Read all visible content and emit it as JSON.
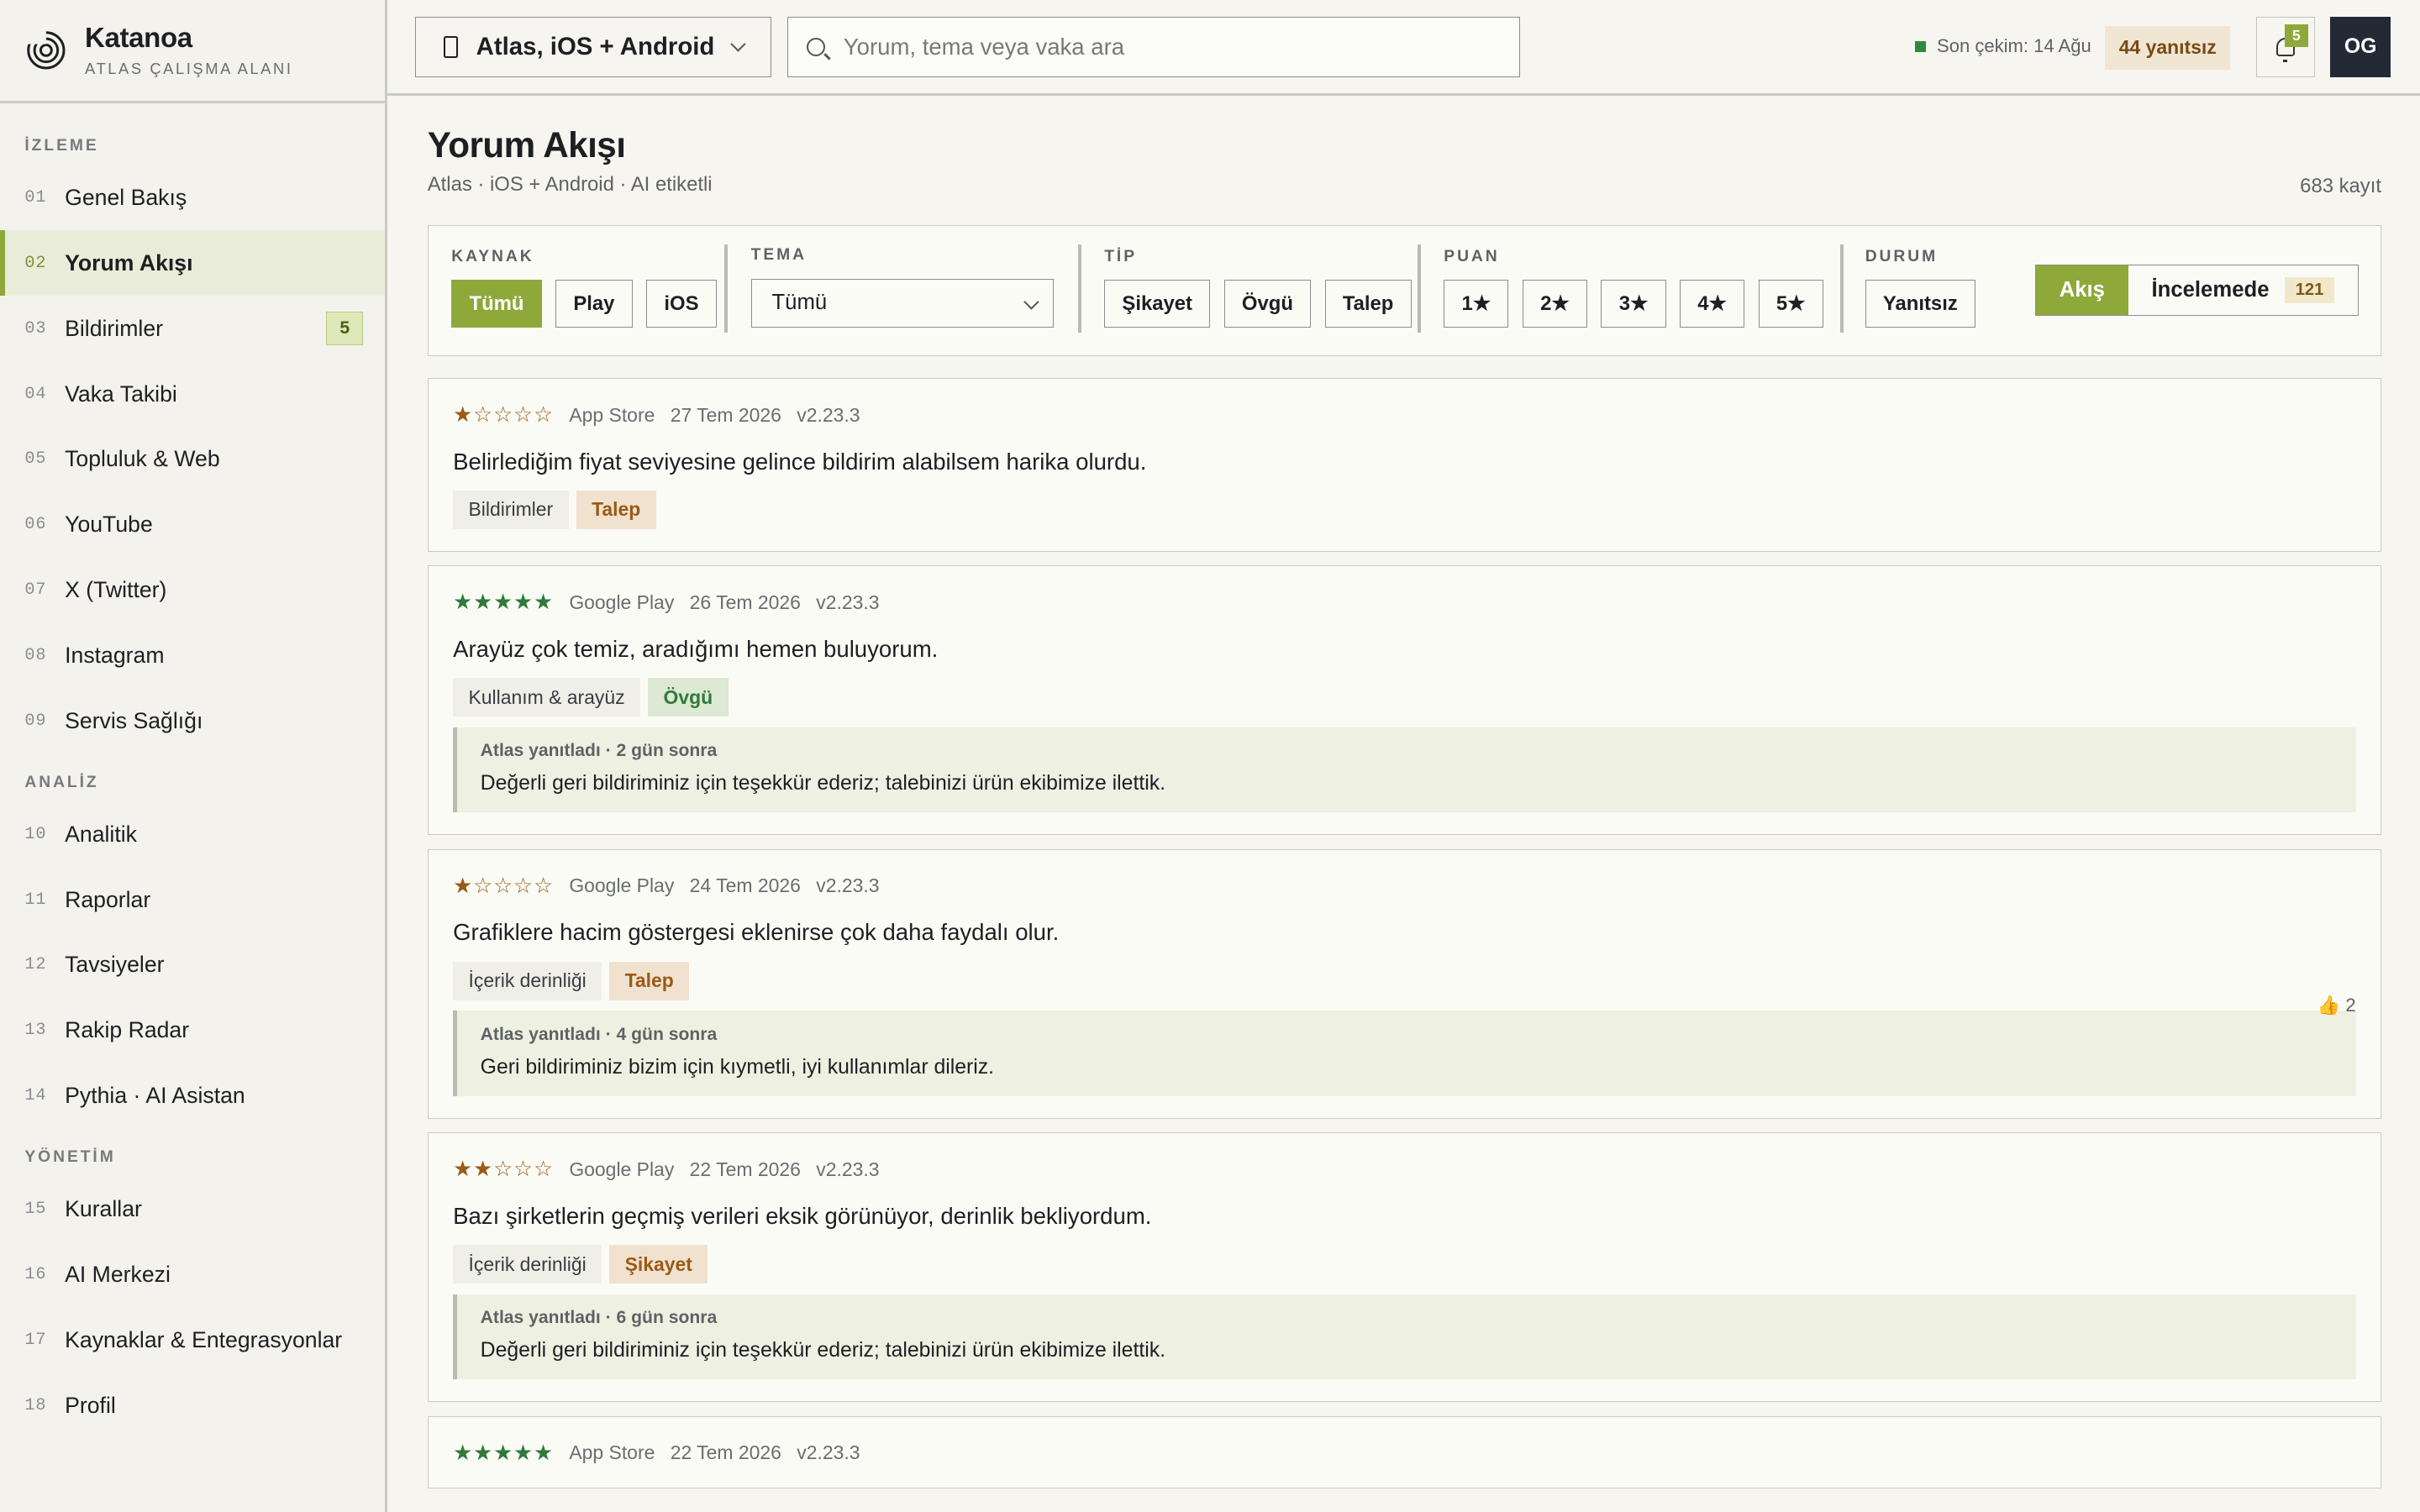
{
  "brand": {
    "name": "Katanoa",
    "subtitle": "ATLAS ÇALIŞMA ALANI"
  },
  "sidebar": {
    "sections": [
      {
        "title": "İZLEME",
        "items": [
          {
            "num": "01",
            "label": "Genel Bakış"
          },
          {
            "num": "02",
            "label": "Yorum Akışı",
            "active": true
          },
          {
            "num": "03",
            "label": "Bildirimler",
            "badge": "5"
          },
          {
            "num": "04",
            "label": "Vaka Takibi"
          },
          {
            "num": "05",
            "label": "Topluluk & Web"
          },
          {
            "num": "06",
            "label": "YouTube"
          },
          {
            "num": "07",
            "label": "X (Twitter)"
          },
          {
            "num": "08",
            "label": "Instagram"
          },
          {
            "num": "09",
            "label": "Servis Sağlığı"
          }
        ]
      },
      {
        "title": "ANALİZ",
        "items": [
          {
            "num": "10",
            "label": "Analitik"
          },
          {
            "num": "11",
            "label": "Raporlar"
          },
          {
            "num": "12",
            "label": "Tavsiyeler"
          },
          {
            "num": "13",
            "label": "Rakip Radar"
          },
          {
            "num": "14",
            "label": "Pythia · AI Asistan"
          }
        ]
      },
      {
        "title": "YÖNETİM",
        "items": [
          {
            "num": "15",
            "label": "Kurallar"
          },
          {
            "num": "16",
            "label": "AI Merkezi"
          },
          {
            "num": "17",
            "label": "Kaynaklar & Entegrasyonlar"
          },
          {
            "num": "18",
            "label": "Profil"
          }
        ]
      }
    ]
  },
  "topbar": {
    "workspace": "Atlas, iOS + Android",
    "search_placeholder": "Yorum, tema veya vaka ara",
    "last_sync": "Son çekim: 14 Ağu",
    "unanswered": "44 yanıtsız",
    "notifications": "5",
    "avatar": "OG"
  },
  "page": {
    "title": "Yorum Akışı",
    "subtitle": "Atlas · iOS + Android · AI etiketli",
    "count": "683 kayıt"
  },
  "filters": {
    "source": {
      "label": "KAYNAK",
      "options": [
        "Tümü",
        "Play",
        "iOS"
      ],
      "active": "Tümü"
    },
    "theme": {
      "label": "TEMA",
      "value": "Tümü"
    },
    "type": {
      "label": "TİP",
      "options": [
        "Şikayet",
        "Övgü",
        "Talep"
      ]
    },
    "rating": {
      "label": "PUAN",
      "options": [
        "1★",
        "2★",
        "3★",
        "4★",
        "5★"
      ]
    },
    "status": {
      "label": "DURUM",
      "options": [
        "Yanıtsız"
      ]
    },
    "view": {
      "flow": "Akış",
      "review": "İncelemede",
      "review_count": "121"
    }
  },
  "reviews": [
    {
      "rating": 1,
      "source": "App Store",
      "date": "27 Tem 2026",
      "version": "v2.23.3",
      "text": "Belirlediğim fiyat seviyesine gelince bildirim alabilsem harika olurdu.",
      "theme": "Bildirimler",
      "type": "Talep",
      "type_class": "talep"
    },
    {
      "rating": 5,
      "source": "Google Play",
      "date": "26 Tem 2026",
      "version": "v2.23.3",
      "text": "Arayüz çok temiz, aradığımı hemen buluyorum.",
      "theme": "Kullanım & arayüz",
      "type": "Övgü",
      "type_class": "ovgu",
      "reply": {
        "head": "Atlas yanıtladı · 2 gün sonra",
        "text": "Değerli geri bildiriminiz için teşekkür ederiz; talebinizi ürün ekibimize ilettik."
      }
    },
    {
      "rating": 1,
      "source": "Google Play",
      "date": "24 Tem 2026",
      "version": "v2.23.3",
      "text": "Grafiklere hacim göstergesi eklenirse çok daha faydalı olur.",
      "theme": "İçerik derinliği",
      "type": "Talep",
      "type_class": "talep",
      "likes": "👍 2",
      "reply": {
        "head": "Atlas yanıtladı · 4 gün sonra",
        "text": "Geri bildiriminiz bizim için kıymetli, iyi kullanımlar dileriz."
      }
    },
    {
      "rating": 2,
      "source": "Google Play",
      "date": "22 Tem 2026",
      "version": "v2.23.3",
      "text": "Bazı şirketlerin geçmiş verileri eksik görünüyor, derinlik bekliyordum.",
      "theme": "İçerik derinliği",
      "type": "Şikayet",
      "type_class": "sikayet",
      "reply": {
        "head": "Atlas yanıtladı · 6 gün sonra",
        "text": "Değerli geri bildiriminiz için teşekkür ederiz; talebinizi ürün ekibimize ilettik."
      }
    },
    {
      "rating": 5,
      "source": "App Store",
      "date": "22 Tem 2026",
      "version": "v2.23.3"
    }
  ]
}
